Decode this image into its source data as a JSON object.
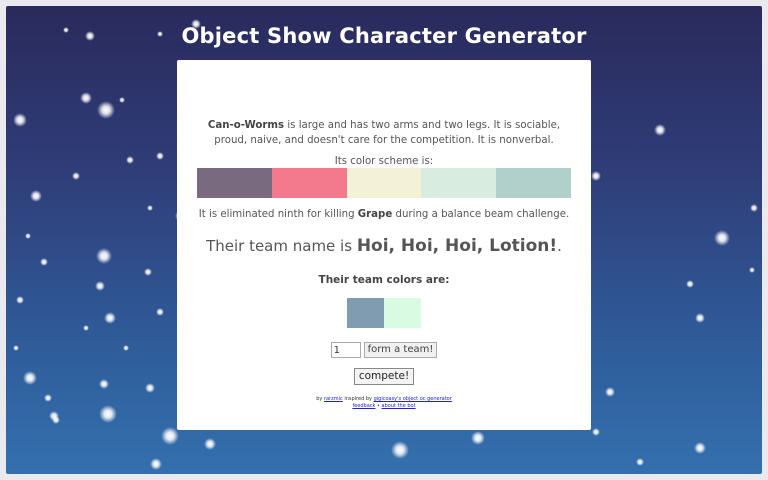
{
  "page": {
    "title": "Object Show Character Generator"
  },
  "character": {
    "name": "Can-o-Worms",
    "description_rest": " is large and has two arms and two legs. It is sociable, proud, naive, and doesn't care for the competition. It is nonverbal.",
    "scheme_label": "Its color scheme is:",
    "color_scheme": [
      "#7a6a80",
      "#f37a8c",
      "#f3f1d7",
      "#d8ecdf",
      "#b1d0cc"
    ],
    "elimination_prefix": "It is eliminated ninth for killing ",
    "elimination_victim": "Grape",
    "elimination_suffix": " during a balance beam challenge."
  },
  "team": {
    "name_prefix": "Their team name is ",
    "name": "Hoi, Hoi, Hoi, Lotion!",
    "name_suffix": ".",
    "colors_label": "Their team colors are:",
    "colors": [
      "#7f9cb0",
      "#d9fbe2"
    ]
  },
  "controls": {
    "team_count_value": "1",
    "form_team_label": "form a team!",
    "compete_label": "compete!"
  },
  "credits": {
    "by_text": "by ",
    "author": "rarzmic",
    "inspired_text": " inspired by ",
    "inspiration": "gigicoasy's object oc generator",
    "feedback": "feedback",
    "separator": " • ",
    "about": "about the bot"
  },
  "colors": {
    "background_top": "#2a2a5c",
    "background_bottom": "#3470ae",
    "card": "#ffffff",
    "title": "#ffffff"
  }
}
